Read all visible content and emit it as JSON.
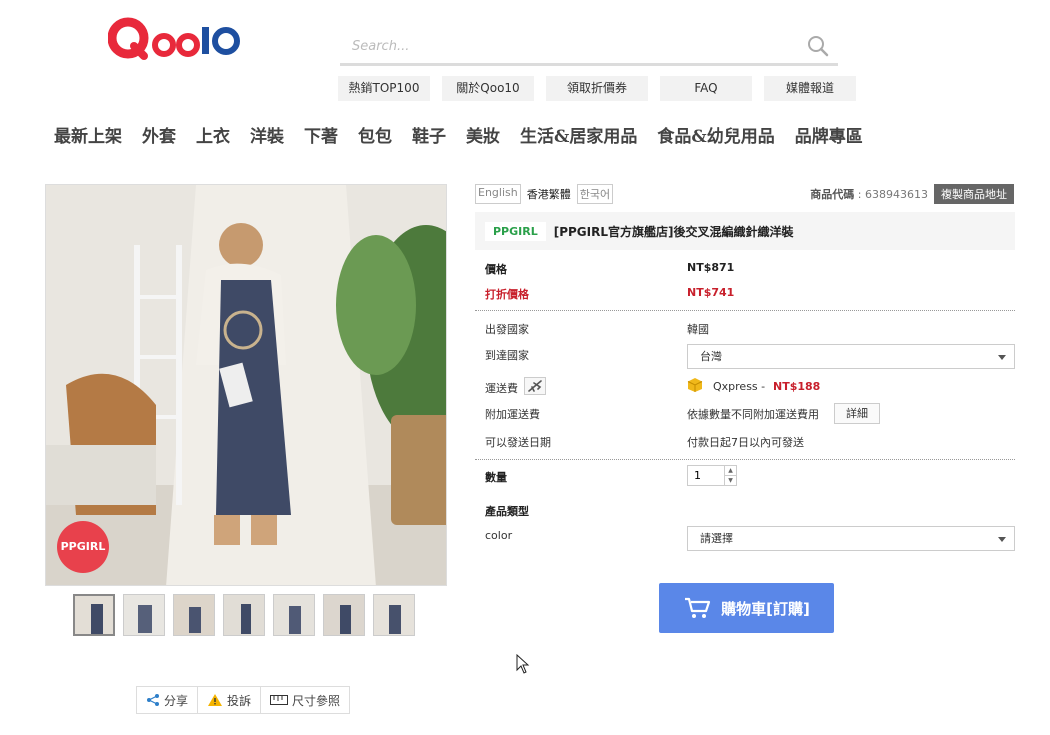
{
  "header": {
    "logo_text": "Qoo10",
    "search_placeholder": "Search...",
    "quicklinks": [
      "熱銷TOP100",
      "關於Qoo10",
      "領取折價券",
      "FAQ",
      "媒體報道"
    ]
  },
  "categories": [
    "最新上架",
    "外套",
    "上衣",
    "洋裝",
    "下著",
    "包包",
    "鞋子",
    "美妝",
    "生活&居家用品",
    "食品&幼兒用品",
    "品牌專區"
  ],
  "gallery": {
    "badge": "PPGIRL",
    "thumb_count": 7
  },
  "share_bar": {
    "share": "分享",
    "report": "投訴",
    "size": "尺寸參照"
  },
  "languages": [
    "English",
    "香港繁體",
    "한국어"
  ],
  "product": {
    "code_label": "商品代碼",
    "code_value": ": 638943613",
    "copy_button": "複製商品地址",
    "brand": "PPGIRL",
    "title": "[PPGIRL官方旗艦店]後交叉混編織針織洋裝"
  },
  "pricing": {
    "price_label": "價格",
    "price_value": "NT$871",
    "discount_label": "打折價格",
    "discount_value": "NT$741"
  },
  "shipping": {
    "origin_label": "出發國家",
    "origin_value": "韓國",
    "dest_label": "到達國家",
    "dest_value": "台灣",
    "fee_label": "運送費",
    "carrier": "Qxpress -",
    "fee_value": "NT$188",
    "extra_label": "附加運送費",
    "extra_value": "依據數量不同附加運送費用",
    "detail_button": "詳細",
    "date_label": "可以發送日期",
    "date_value": "付款日起7日以內可發送"
  },
  "options": {
    "qty_label": "數量",
    "qty_value": "1",
    "type_label": "產品類型",
    "color_label": "color",
    "color_placeholder": "請選擇"
  },
  "cart": {
    "label": "購物車[訂購]"
  },
  "colors": {
    "logo_red": "#e8293b",
    "logo_blue": "#1e4fa0",
    "cart_blue": "#5a87e8",
    "price_red": "#c8202c",
    "brand_green": "#2aa04a"
  }
}
